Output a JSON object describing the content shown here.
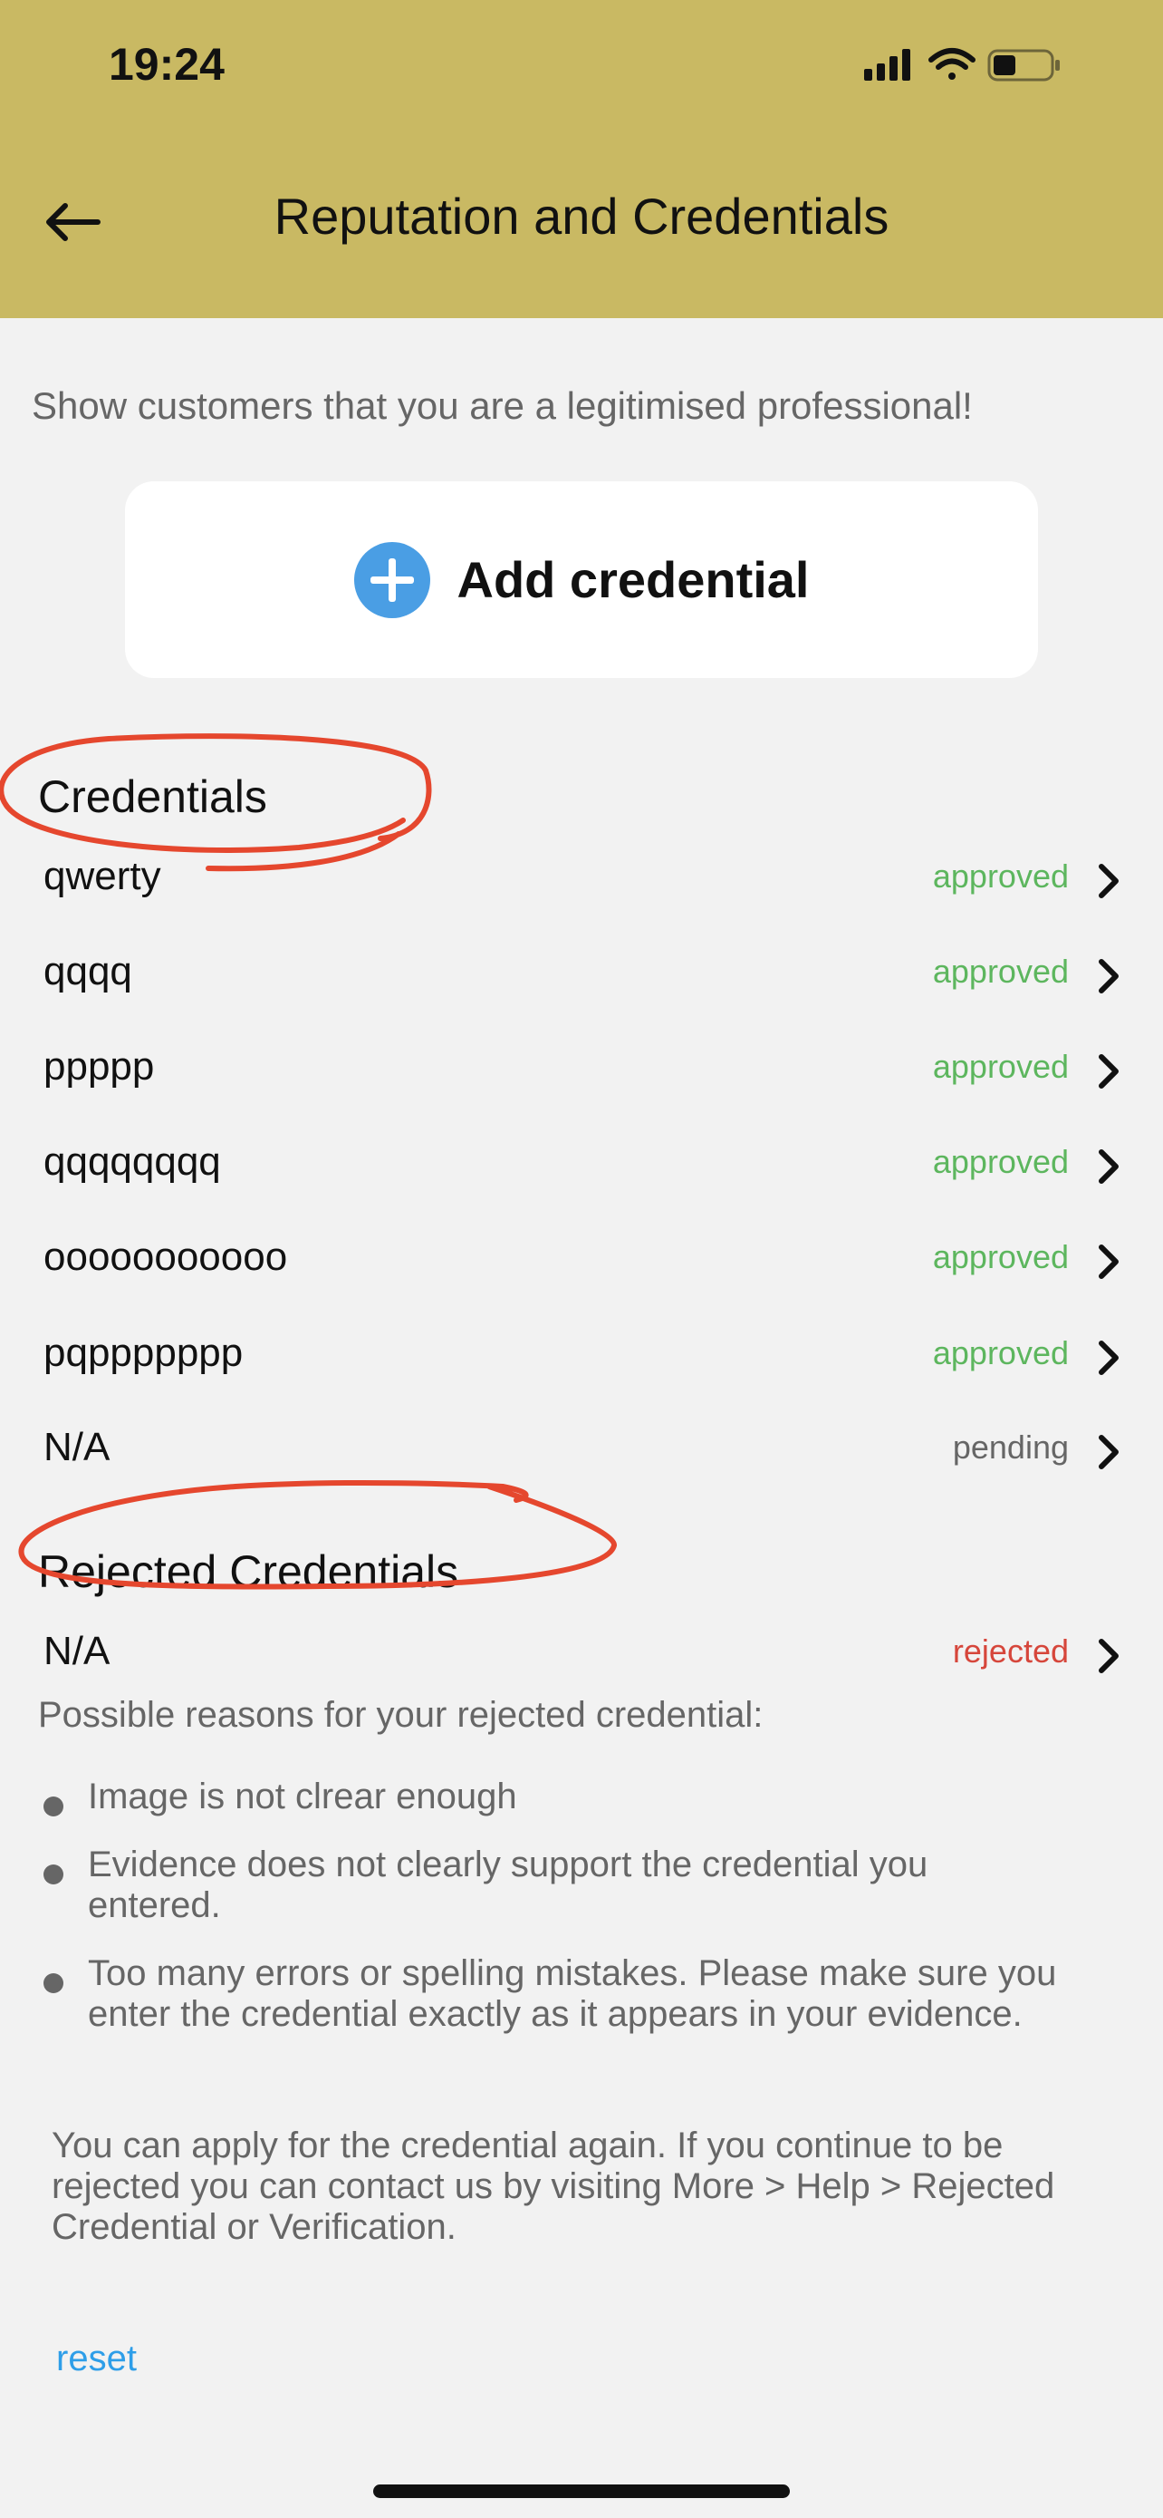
{
  "status_bar": {
    "time": "19:24"
  },
  "header": {
    "title": "Reputation and Credentials"
  },
  "intro": "Show customers that you are a legitimised professional!",
  "add_button": {
    "label": "Add credential"
  },
  "credentials": {
    "title": "Credentials",
    "items": [
      {
        "name": "qwerty",
        "status": "approved"
      },
      {
        "name": "qqqq",
        "status": "approved"
      },
      {
        "name": "ppppp",
        "status": "approved"
      },
      {
        "name": "qqqqqqqq",
        "status": "approved"
      },
      {
        "name": "ooooooooooo",
        "status": "approved"
      },
      {
        "name": "pqppppppp",
        "status": "approved"
      },
      {
        "name": "N/A",
        "status": "pending"
      }
    ]
  },
  "rejected": {
    "title": "Rejected Credentials",
    "items": [
      {
        "name": "N/A",
        "status": "rejected"
      }
    ],
    "reasons_title": "Possible reasons for your rejected credential:",
    "reasons": [
      "Image is not clrear enough",
      "Evidence does not clearly support the credential you entered.",
      "Too many errors or spelling mistakes. Please make sure you enter the credential exactly as it appears in your evidence."
    ],
    "note": "You can apply for the credential again. If you continue to be rejected you can contact us by visiting More > Help > Rejected Credential or Verification."
  },
  "reset_link": "reset",
  "colors": {
    "header_bg": "#c9b963",
    "approved": "#5db65e",
    "pending": "#666666",
    "rejected": "#d6463b",
    "link": "#2e9ee8",
    "annotation": "#e5472e"
  }
}
